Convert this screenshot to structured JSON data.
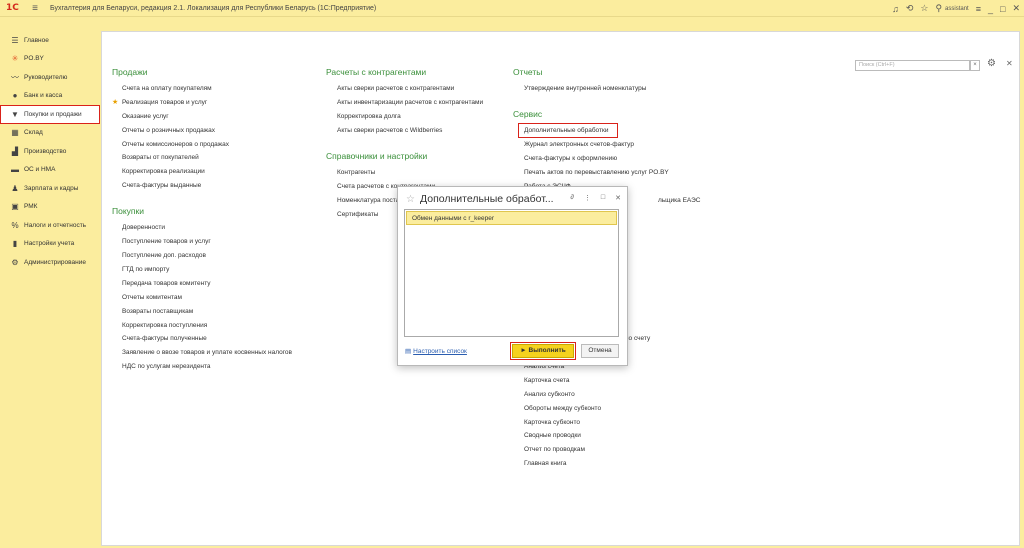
{
  "app": {
    "logo": "1С",
    "title": "Бухгалтерия для Беларуси, редакция 2.1. Локализация для Республики Беларусь (1С:Предприятие)",
    "user": "assistant"
  },
  "sidebar": {
    "items": [
      {
        "label": "Главное",
        "icon": "list-icon"
      },
      {
        "label": "PO.BY",
        "icon": "asterisk-icon"
      },
      {
        "label": "Руководителю",
        "icon": "trend-icon"
      },
      {
        "label": "Банк и касса",
        "icon": "coin-icon"
      },
      {
        "label": "Покупки и продажи",
        "icon": "cart-icon"
      },
      {
        "label": "Склад",
        "icon": "warehouse-icon"
      },
      {
        "label": "Производство",
        "icon": "factory-icon"
      },
      {
        "label": "ОС и НМА",
        "icon": "truck-icon"
      },
      {
        "label": "Зарплата и кадры",
        "icon": "person-icon"
      },
      {
        "label": "РМК",
        "icon": "register-icon"
      },
      {
        "label": "Налоги и отчетность",
        "icon": "tax-icon"
      },
      {
        "label": "Настройки учета",
        "icon": "book-icon"
      },
      {
        "label": "Администрирование",
        "icon": "gear-icon"
      }
    ]
  },
  "search": {
    "placeholder": "Поиск (Ctrl+F)"
  },
  "sections": {
    "sales": {
      "title": "Продажи",
      "links": [
        "Счета на оплату покупателям",
        "Реализация товаров и услуг",
        "Оказание услуг",
        "Отчеты о розничных продажах",
        "Отчеты комиссионеров о продажах",
        "Возвраты от покупателей",
        "Корректировка реализации",
        "Счета-фактуры выданные"
      ]
    },
    "purchases": {
      "title": "Покупки",
      "links": [
        "Доверенности",
        "Поступление товаров и услуг",
        "Поступление доп. расходов",
        "ГТД по импорту",
        "Передача товаров комитенту",
        "Отчеты комитентам",
        "Возвраты поставщикам",
        "Корректировка поступления",
        "Счета-фактуры полученные",
        "Заявление о ввозе товаров и уплате косвенных налогов",
        "НДС по услугам нерезидента"
      ]
    },
    "settlements": {
      "title": "Расчеты с контрагентами",
      "links": [
        "Акты сверки расчетов с контрагентами",
        "Акты инвентаризации расчетов с контрагентами",
        "Корректировка долга",
        "Акты сверки расчетов с Wildberries"
      ]
    },
    "directories": {
      "title": "Справочники и настройки",
      "links": [
        "Контрагенты",
        "Счета расчетов с контрагентами",
        "Номенклатура поставщиков",
        "Сертификаты"
      ]
    },
    "reports": {
      "title": "Отчеты",
      "links": [
        "Утверждение внутренней номенклатуры"
      ]
    },
    "service": {
      "title": "Сервис",
      "links": [
        "Дополнительные обработки",
        "Журнал электронных счетов-фактур",
        "Счета-фактуры к оформлению",
        "Печать актов по перевыставлению услуг PO.BY",
        "Работа с ЭСЧФ",
        "Отчет для уполномоченного органа ЕАЭС"
      ],
      "partial": [
        "ПЭСЧФ",
        "льщика ЕАЭС",
        "по счету"
      ],
      "more_links": [
        "Анализ счета",
        "Карточка счета",
        "Анализ субконто",
        "Обороты между субконто",
        "Карточка субконто",
        "Сводные проводки",
        "Отчет по проводкам",
        "Главная книга"
      ]
    }
  },
  "modal": {
    "title": "Дополнительные обработ...",
    "selected_item": "Обмен данными с r_keeper",
    "configure_label": "Настроить список",
    "run_label": "► Выполнить",
    "cancel_label": "Отмена"
  }
}
